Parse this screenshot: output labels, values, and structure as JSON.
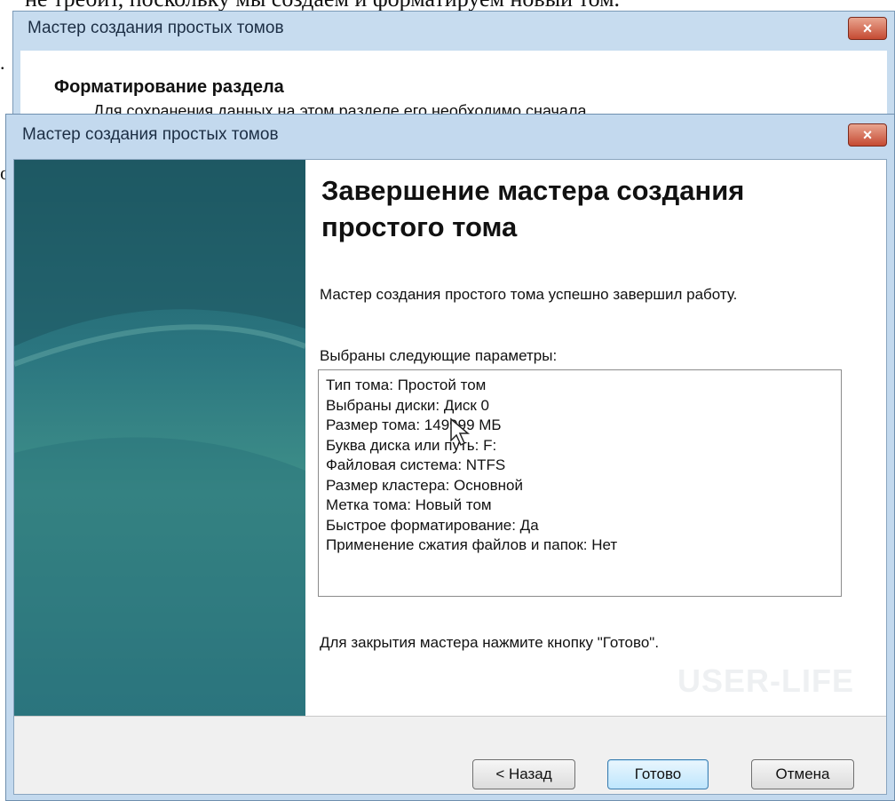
{
  "page_text": {
    "top_line": "не требит, поскольку мы создаем и форматируем новый том.",
    "left_fragment_1": ".",
    "left_fragment_2": "о"
  },
  "back_dialog": {
    "title": "Мастер создания простых томов",
    "close_label": "×",
    "heading": "Форматирование раздела",
    "description": "Для сохранения данных на этом разделе его необходимо сначала"
  },
  "front_dialog": {
    "title": "Мастер создания простых томов",
    "close_label": "×",
    "heading": "Завершение мастера создания простого тома",
    "completion_text": "Мастер создания простого тома успешно завершил работу.",
    "params_label": "Выбраны следующие параметры:",
    "params": [
      "Тип тома: Простой том",
      "Выбраны диски: Диск 0",
      "Размер тома: 149999 МБ",
      "Буква диска или путь: F:",
      "Файловая система: NTFS",
      "Размер кластера: Основной",
      "Метка тома: Новый том",
      "Быстрое форматирование: Да",
      "Применение сжатия файлов и папок: Нет"
    ],
    "closing_text": "Для закрытия мастера нажмите кнопку \"Готово\".",
    "watermark": "USER-LIFE",
    "buttons": {
      "back": "< Назад",
      "finish": "Готово",
      "cancel": "Отмена"
    }
  },
  "colors": {
    "title_bar": "#c3d9ee",
    "banner": "#2b7680",
    "close_button": "#c54a32"
  }
}
